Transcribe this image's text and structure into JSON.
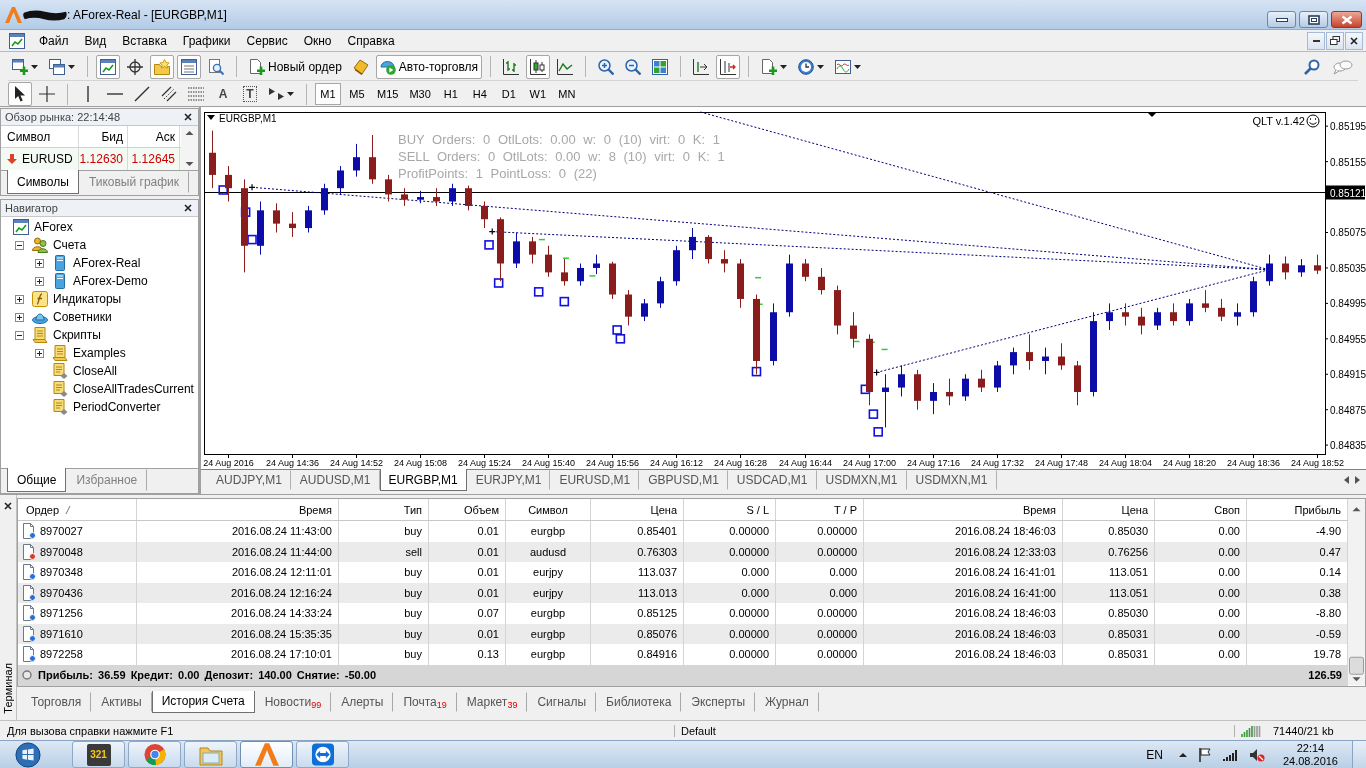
{
  "window": {
    "title": ": AForex-Real - [EURGBP,M1]"
  },
  "menu": [
    "Файл",
    "Вид",
    "Вставка",
    "Графики",
    "Сервис",
    "Окно",
    "Справка"
  ],
  "toolbar_1": {
    "groups": [
      [
        {
          "kind": "newchart",
          "dropdown": true,
          "pressed": false
        },
        {
          "kind": "profiles",
          "dropdown": true,
          "pressed": false
        }
      ],
      [
        {
          "kind": "marketwatch",
          "pressed": true
        },
        {
          "kind": "datawindow",
          "pressed": false
        },
        {
          "kind": "navigator",
          "pressed": true
        },
        {
          "kind": "terminal",
          "pressed": true
        },
        {
          "kind": "tester",
          "pressed": false
        }
      ],
      [
        {
          "kind": "order",
          "label": "Новый ордер",
          "pressed": false
        },
        {
          "kind": "editor",
          "pressed": false
        },
        {
          "kind": "autotrading",
          "label": "Авто-торговля",
          "pressed": true
        }
      ],
      [
        {
          "kind": "bars",
          "pressed": false
        },
        {
          "kind": "candles",
          "pressed": true
        },
        {
          "kind": "line",
          "pressed": false
        }
      ],
      [
        {
          "kind": "zoomin",
          "pressed": false
        },
        {
          "kind": "zoomout",
          "pressed": false
        },
        {
          "kind": "tile",
          "pressed": false
        }
      ],
      [
        {
          "kind": "shift",
          "pressed": false
        },
        {
          "kind": "autoscroll",
          "pressed": true
        }
      ],
      [
        {
          "kind": "indicators",
          "dropdown": true,
          "pressed": false
        },
        {
          "kind": "periods",
          "dropdown": true,
          "pressed": false
        },
        {
          "kind": "templates",
          "dropdown": true,
          "pressed": false
        }
      ]
    ]
  },
  "toolbar_2": {
    "groups": [
      [
        {
          "kind": "cursor",
          "pressed": true
        },
        {
          "kind": "crosshair",
          "pressed": false
        }
      ],
      [
        {
          "kind": "vline",
          "pressed": false
        },
        {
          "kind": "hline",
          "pressed": false
        },
        {
          "kind": "trendline",
          "pressed": false
        },
        {
          "kind": "channel",
          "pressed": false
        },
        {
          "kind": "fibo",
          "pressed": false
        },
        {
          "kind": "text",
          "glyph": "A",
          "pressed": false
        },
        {
          "kind": "label",
          "glyph": "T",
          "pressed": false
        },
        {
          "kind": "arrows",
          "dropdown": true,
          "pressed": false
        }
      ]
    ],
    "timeframes": [
      {
        "label": "M1",
        "selected": true
      },
      {
        "label": "M5",
        "selected": false
      },
      {
        "label": "M15",
        "selected": false
      },
      {
        "label": "M30",
        "selected": false
      },
      {
        "label": "H1",
        "selected": false
      },
      {
        "label": "H4",
        "selected": false
      },
      {
        "label": "D1",
        "selected": false
      },
      {
        "label": "W1",
        "selected": false
      },
      {
        "label": "MN",
        "selected": false
      }
    ]
  },
  "market_watch": {
    "title": "Обзор рынка: 22:14:48",
    "columns": [
      "Символ",
      "Бид",
      "Аск"
    ],
    "rows": [
      {
        "symbol": "EURUSD",
        "bid": "1.12630",
        "ask": "1.12645",
        "falling": true
      }
    ],
    "tabs": [
      {
        "label": "Символы",
        "selected": true
      },
      {
        "label": "Тиковый график",
        "selected": false
      }
    ]
  },
  "navigator": {
    "title": "Навигатор",
    "tree": [
      {
        "label": "AForex",
        "kind": "terminal",
        "children": [
          {
            "label": "Счета",
            "kind": "accounts",
            "expanded": true,
            "children": [
              {
                "label": "AForex-Real",
                "kind": "server",
                "expanded": false
              },
              {
                "label": "AForex-Demo",
                "kind": "server",
                "expanded": false
              }
            ]
          },
          {
            "label": "Индикаторы",
            "kind": "indicators",
            "expanded": false
          },
          {
            "label": "Советники",
            "kind": "experts",
            "expanded": false
          },
          {
            "label": "Скрипты",
            "kind": "scripts",
            "expanded": true,
            "children": [
              {
                "label": "Examples",
                "kind": "scripts",
                "expanded": false
              },
              {
                "label": "CloseAll",
                "kind": "script"
              },
              {
                "label": "CloseAllTradesCurrent",
                "kind": "script"
              },
              {
                "label": "PeriodConverter",
                "kind": "script"
              }
            ]
          }
        ]
      }
    ],
    "tabs": [
      {
        "label": "Общие",
        "selected": true
      },
      {
        "label": "Избранное",
        "selected": false
      }
    ]
  },
  "chart": {
    "expert": "QLT v.1.42",
    "chart_data": [
      {
        "type": "candlestick",
        "title": "EURGBP,M1",
        "x": [
          "2016-08-24T14:16",
          "2016-08-24T14:20",
          "2016-08-24T14:24",
          "2016-08-24T14:28",
          "2016-08-24T14:32",
          "2016-08-24T14:36",
          "2016-08-24T14:40",
          "2016-08-24T14:44",
          "2016-08-24T14:48",
          "2016-08-24T14:52",
          "2016-08-24T14:56",
          "2016-08-24T15:00",
          "2016-08-24T15:04",
          "2016-08-24T15:08",
          "2016-08-24T15:12",
          "2016-08-24T15:16",
          "2016-08-24T15:20",
          "2016-08-24T15:24",
          "2016-08-24T15:28",
          "2016-08-24T15:32",
          "2016-08-24T15:36",
          "2016-08-24T15:40",
          "2016-08-24T15:44",
          "2016-08-24T15:48",
          "2016-08-24T15:52",
          "2016-08-24T15:56",
          "2016-08-24T16:00",
          "2016-08-24T16:04",
          "2016-08-24T16:08",
          "2016-08-24T16:12",
          "2016-08-24T16:16",
          "2016-08-24T16:20",
          "2016-08-24T16:24",
          "2016-08-24T16:28",
          "2016-08-24T16:32",
          "2016-08-24T16:36",
          "2016-08-24T16:40",
          "2016-08-24T16:44",
          "2016-08-24T16:48",
          "2016-08-24T16:52",
          "2016-08-24T16:56",
          "2016-08-24T17:00",
          "2016-08-24T17:04",
          "2016-08-24T17:08",
          "2016-08-24T17:12",
          "2016-08-24T17:16",
          "2016-08-24T17:20",
          "2016-08-24T17:24",
          "2016-08-24T17:28",
          "2016-08-24T17:32",
          "2016-08-24T17:36",
          "2016-08-24T17:40",
          "2016-08-24T17:44",
          "2016-08-24T17:48",
          "2016-08-24T17:52",
          "2016-08-24T17:56",
          "2016-08-24T18:00",
          "2016-08-24T18:04",
          "2016-08-24T18:08",
          "2016-08-24T18:12",
          "2016-08-24T18:16",
          "2016-08-24T18:20",
          "2016-08-24T18:24",
          "2016-08-24T18:28",
          "2016-08-24T18:32",
          "2016-08-24T18:36",
          "2016-08-24T18:40",
          "2016-08-24T18:44",
          "2016-08-24T18:48",
          "2016-08-24T18:52"
        ],
        "ohlc": [
          [
            0.85165,
            0.8519,
            0.85125,
            0.8514
          ],
          [
            0.8514,
            0.8515,
            0.8511,
            0.85125
          ],
          [
            0.85125,
            0.85135,
            0.8503,
            0.8506
          ],
          [
            0.8506,
            0.8511,
            0.8505,
            0.851
          ],
          [
            0.851,
            0.85108,
            0.85075,
            0.85085
          ],
          [
            0.85085,
            0.85098,
            0.8507,
            0.8508
          ],
          [
            0.8508,
            0.85105,
            0.85075,
            0.851
          ],
          [
            0.851,
            0.8513,
            0.85095,
            0.85125
          ],
          [
            0.85125,
            0.8515,
            0.85118,
            0.85145
          ],
          [
            0.85145,
            0.85175,
            0.85138,
            0.8516
          ],
          [
            0.8516,
            0.85185,
            0.8513,
            0.85135
          ],
          [
            0.85135,
            0.8514,
            0.8511,
            0.85118
          ],
          [
            0.85118,
            0.85125,
            0.85105,
            0.85112
          ],
          [
            0.85112,
            0.85122,
            0.85108,
            0.85115
          ],
          [
            0.85115,
            0.85125,
            0.85105,
            0.8511
          ],
          [
            0.8511,
            0.8513,
            0.85105,
            0.85125
          ],
          [
            0.85125,
            0.85128,
            0.851,
            0.85105
          ],
          [
            0.85105,
            0.8511,
            0.8508,
            0.8509
          ],
          [
            0.8509,
            0.85092,
            0.8502,
            0.8504
          ],
          [
            0.8504,
            0.85075,
            0.85035,
            0.85065
          ],
          [
            0.85065,
            0.8507,
            0.8504,
            0.8505
          ],
          [
            0.8505,
            0.8506,
            0.85025,
            0.8503
          ],
          [
            0.8503,
            0.85045,
            0.85015,
            0.8502
          ],
          [
            0.8502,
            0.8504,
            0.85015,
            0.85035
          ],
          [
            0.85035,
            0.8505,
            0.85028,
            0.8504
          ],
          [
            0.8504,
            0.85042,
            0.85,
            0.85005
          ],
          [
            0.85005,
            0.8501,
            0.8497,
            0.8498
          ],
          [
            0.8498,
            0.85,
            0.84975,
            0.84995
          ],
          [
            0.84995,
            0.85025,
            0.8499,
            0.8502
          ],
          [
            0.8502,
            0.8506,
            0.85015,
            0.85055
          ],
          [
            0.85055,
            0.8508,
            0.85045,
            0.8507
          ],
          [
            0.8507,
            0.85072,
            0.8504,
            0.85045
          ],
          [
            0.85045,
            0.85055,
            0.8503,
            0.8504
          ],
          [
            0.8504,
            0.85045,
            0.8499,
            0.85
          ],
          [
            0.85,
            0.85005,
            0.84915,
            0.8493
          ],
          [
            0.8493,
            0.84995,
            0.84925,
            0.84985
          ],
          [
            0.84985,
            0.8505,
            0.8498,
            0.8504
          ],
          [
            0.8504,
            0.85045,
            0.8502,
            0.85025
          ],
          [
            0.85025,
            0.85035,
            0.85005,
            0.8501
          ],
          [
            0.8501,
            0.85015,
            0.8496,
            0.8497
          ],
          [
            0.8497,
            0.84985,
            0.84945,
            0.84955
          ],
          [
            0.84955,
            0.8496,
            0.8488,
            0.84895
          ],
          [
            0.84895,
            0.84915,
            0.84855,
            0.849
          ],
          [
            0.849,
            0.84925,
            0.8489,
            0.84915
          ],
          [
            0.84915,
            0.8492,
            0.84875,
            0.84885
          ],
          [
            0.84885,
            0.84905,
            0.8487,
            0.84895
          ],
          [
            0.84895,
            0.8491,
            0.8488,
            0.8489
          ],
          [
            0.8489,
            0.84915,
            0.84885,
            0.8491
          ],
          [
            0.8491,
            0.8492,
            0.84895,
            0.849
          ],
          [
            0.849,
            0.8493,
            0.84895,
            0.84925
          ],
          [
            0.84925,
            0.84945,
            0.84915,
            0.8494
          ],
          [
            0.8494,
            0.8496,
            0.8492,
            0.8493
          ],
          [
            0.8493,
            0.84945,
            0.84915,
            0.84935
          ],
          [
            0.84935,
            0.8495,
            0.8492,
            0.84925
          ],
          [
            0.84925,
            0.8493,
            0.8488,
            0.84895
          ],
          [
            0.84895,
            0.84985,
            0.8489,
            0.84975
          ],
          [
            0.84975,
            0.84995,
            0.84965,
            0.84985
          ],
          [
            0.84985,
            0.84995,
            0.8497,
            0.8498
          ],
          [
            0.8498,
            0.8499,
            0.8496,
            0.8497
          ],
          [
            0.8497,
            0.8499,
            0.84965,
            0.84985
          ],
          [
            0.84985,
            0.84995,
            0.8497,
            0.84975
          ],
          [
            0.84975,
            0.85,
            0.8497,
            0.84995
          ],
          [
            0.84995,
            0.8501,
            0.84985,
            0.8499
          ],
          [
            0.8499,
            0.85,
            0.84975,
            0.8498
          ],
          [
            0.8498,
            0.84995,
            0.8497,
            0.84985
          ],
          [
            0.84985,
            0.85025,
            0.8498,
            0.8502
          ],
          [
            0.8502,
            0.8505,
            0.85015,
            0.8504
          ],
          [
            0.8504,
            0.85048,
            0.85022,
            0.8503
          ],
          [
            0.8503,
            0.85045,
            0.85025,
            0.85038
          ],
          [
            0.85038,
            0.8505,
            0.85028,
            0.85032
          ]
        ],
        "series": [
          {
            "type": "line",
            "color": "#00007a",
            "line_style": "dotted",
            "x": [
              "2016-08-24T14:26",
              "2016-08-24T18:40"
            ],
            "values": [
              0.85126,
              0.85033
            ]
          },
          {
            "type": "line",
            "color": "#00007a",
            "line_style": "dotted",
            "x": [
              "2016-08-24T15:26",
              "2016-08-24T18:40"
            ],
            "values": [
              0.85076,
              0.85033
            ]
          },
          {
            "type": "line",
            "color": "#00007a",
            "line_style": "dotted",
            "x": [
              "2016-08-24T16:18",
              "2016-08-24T18:40"
            ],
            "values": [
              0.85211,
              0.85033
            ]
          },
          {
            "type": "line",
            "color": "#00007a",
            "line_style": "dotted",
            "x": [
              "2016-08-24T17:02",
              "2016-08-24T18:40"
            ],
            "values": [
              0.84917,
              0.85033
            ]
          },
          {
            "type": "scatter",
            "color": "#000000",
            "marker": "cross",
            "x": [
              "2016-08-24T14:26",
              "2016-08-24T15:26",
              "2016-08-24T17:02"
            ],
            "values": [
              0.85126,
              0.85076,
              0.84917
            ]
          }
        ],
        "xlim": [
          "2016-08-24T14:14",
          "2016-08-24T18:54"
        ],
        "xticks": [
          {
            "value": "2016-08-24T14:20",
            "label": "24 Aug 2016"
          },
          {
            "value": "2016-08-24T14:36",
            "label": "24 Aug 14:36"
          },
          {
            "value": "2016-08-24T14:52",
            "label": "24 Aug 14:52"
          },
          {
            "value": "2016-08-24T15:08",
            "label": "24 Aug 15:08"
          },
          {
            "value": "2016-08-24T15:24",
            "label": "24 Aug 15:24"
          },
          {
            "value": "2016-08-24T15:40",
            "label": "24 Aug 15:40"
          },
          {
            "value": "2016-08-24T15:56",
            "label": "24 Aug 15:56"
          },
          {
            "value": "2016-08-24T16:12",
            "label": "24 Aug 16:12"
          },
          {
            "value": "2016-08-24T16:28",
            "label": "24 Aug 16:28"
          },
          {
            "value": "2016-08-24T16:44",
            "label": "24 Aug 16:44"
          },
          {
            "value": "2016-08-24T17:00",
            "label": "24 Aug 17:00"
          },
          {
            "value": "2016-08-24T17:16",
            "label": "24 Aug 17:16"
          },
          {
            "value": "2016-08-24T17:32",
            "label": "24 Aug 17:32"
          },
          {
            "value": "2016-08-24T17:48",
            "label": "24 Aug 17:48"
          },
          {
            "value": "2016-08-24T18:04",
            "label": "24 Aug 18:04"
          },
          {
            "value": "2016-08-24T18:20",
            "label": "24 Aug 18:20"
          },
          {
            "value": "2016-08-24T18:36",
            "label": "24 Aug 18:36"
          },
          {
            "value": "2016-08-24T18:52",
            "label": "24 Aug 18:52"
          }
        ],
        "ylim": [
          0.84825,
          0.85211
        ],
        "yticks": [
          0.84835,
          0.84875,
          0.84915,
          0.84955,
          0.84995,
          0.85035,
          0.85075,
          0.85155,
          0.85195
        ],
        "ref_lines": [
          {
            "axis": "y",
            "value": 0.85121,
            "label": "0.85121",
            "color": "#000000",
            "line_style": "solid"
          }
        ],
        "annotations": [
          "BUY Orders: 0 OtlLots: 0.00 w: 0 (10) virt: 0 K: 1",
          "SELL Orders: 0 OtlLots: 0.00 w: 8 (10) virt: 0 K: 1",
          "ProfitPoints: 1 PointLoss: 0 (22)"
        ]
      }
    ]
  },
  "chart_tabs": [
    {
      "label": "AUDJPY,M1",
      "selected": false
    },
    {
      "label": "AUDUSD,M1",
      "selected": false
    },
    {
      "label": "EURGBP,M1",
      "selected": true
    },
    {
      "label": "EURJPY,M1",
      "selected": false
    },
    {
      "label": "EURUSD,M1",
      "selected": false
    },
    {
      "label": "GBPUSD,M1",
      "selected": false
    },
    {
      "label": "USDCAD,M1",
      "selected": false
    },
    {
      "label": "USDMXN,M1",
      "selected": false
    },
    {
      "label": "USDMXN,M1",
      "selected": false
    }
  ],
  "terminal": {
    "label": "Терминал",
    "columns": [
      {
        "label": "Ордер",
        "sorted": true
      },
      {
        "label": "Время",
        "sorted": false
      },
      {
        "label": "Тип",
        "sorted": false
      },
      {
        "label": "Объем",
        "sorted": false
      },
      {
        "label": "Символ",
        "sorted": false
      },
      {
        "label": "Цена",
        "sorted": false
      },
      {
        "label": "S / L",
        "sorted": false
      },
      {
        "label": "T / P",
        "sorted": false
      },
      {
        "label": "Время",
        "sorted": false
      },
      {
        "label": "Цена",
        "sorted": false
      },
      {
        "label": "Своп",
        "sorted": false
      },
      {
        "label": "Прибыль",
        "sorted": false
      }
    ],
    "rows": [
      {
        "kind": "buy",
        "cells": [
          "8970027",
          "2016.08.24 11:43:00",
          "buy",
          "0.01",
          "eurgbp",
          "0.85401",
          "0.00000",
          "0.00000",
          "2016.08.24 18:46:03",
          "0.85030",
          "0.00",
          "-4.90"
        ]
      },
      {
        "kind": "sell",
        "cells": [
          "8970048",
          "2016.08.24 11:44:00",
          "sell",
          "0.01",
          "audusd",
          "0.76303",
          "0.00000",
          "0.00000",
          "2016.08.24 12:33:03",
          "0.76256",
          "0.00",
          "0.47"
        ]
      },
      {
        "kind": "buy",
        "cells": [
          "8970348",
          "2016.08.24 12:11:01",
          "buy",
          "0.01",
          "eurjpy",
          "113.037",
          "0.000",
          "0.000",
          "2016.08.24 16:41:01",
          "113.051",
          "0.00",
          "0.14"
        ]
      },
      {
        "kind": "buy",
        "cells": [
          "8970436",
          "2016.08.24 12:16:24",
          "buy",
          "0.01",
          "eurjpy",
          "113.013",
          "0.000",
          "0.000",
          "2016.08.24 16:41:00",
          "113.051",
          "0.00",
          "0.38"
        ]
      },
      {
        "kind": "buy",
        "cells": [
          "8971256",
          "2016.08.24 14:33:24",
          "buy",
          "0.07",
          "eurgbp",
          "0.85125",
          "0.00000",
          "0.00000",
          "2016.08.24 18:46:03",
          "0.85030",
          "0.00",
          "-8.80"
        ]
      },
      {
        "kind": "buy",
        "cells": [
          "8971610",
          "2016.08.24 15:35:35",
          "buy",
          "0.01",
          "eurgbp",
          "0.85076",
          "0.00000",
          "0.00000",
          "2016.08.24 18:46:03",
          "0.85031",
          "0.00",
          "-0.59"
        ]
      },
      {
        "kind": "buy",
        "cells": [
          "8972258",
          "2016.08.24 17:10:01",
          "buy",
          "0.13",
          "eurgbp",
          "0.84916",
          "0.00000",
          "0.00000",
          "2016.08.24 18:46:03",
          "0.85031",
          "0.00",
          "19.78"
        ]
      }
    ],
    "summary": {
      "text": "Прибыль: 36.59 Кредит: 0.00 Депозит: 140.00 Снятие: -50.00",
      "total": "126.59"
    },
    "tabs": [
      {
        "label": "Торговля",
        "selected": false
      },
      {
        "label": "Активы",
        "selected": false
      },
      {
        "label": "История Счета",
        "selected": true
      },
      {
        "label": "Новости",
        "badge": "99",
        "selected": false
      },
      {
        "label": "Алерты",
        "selected": false
      },
      {
        "label": "Почта",
        "badge": "19",
        "selected": false
      },
      {
        "label": "Маркет",
        "badge": "39",
        "selected": false
      },
      {
        "label": "Сигналы",
        "selected": false
      },
      {
        "label": "Библиотека",
        "selected": false
      },
      {
        "label": "Эксперты",
        "selected": false
      },
      {
        "label": "Журнал",
        "selected": false
      }
    ]
  },
  "status_bar": {
    "help": "Для вызова справки нажмите F1",
    "profile": "Default",
    "traffic": "71440/21 kb"
  },
  "taskbar": {
    "apps": [
      {
        "kind": "player",
        "logo_text": "321",
        "selected": false
      },
      {
        "kind": "browser",
        "selected": false
      },
      {
        "kind": "files",
        "selected": false
      },
      {
        "kind": "terminal",
        "selected": true
      },
      {
        "kind": "remote",
        "selected": false
      }
    ],
    "language": "EN",
    "time": "22:14",
    "date": "24.08.2016"
  }
}
